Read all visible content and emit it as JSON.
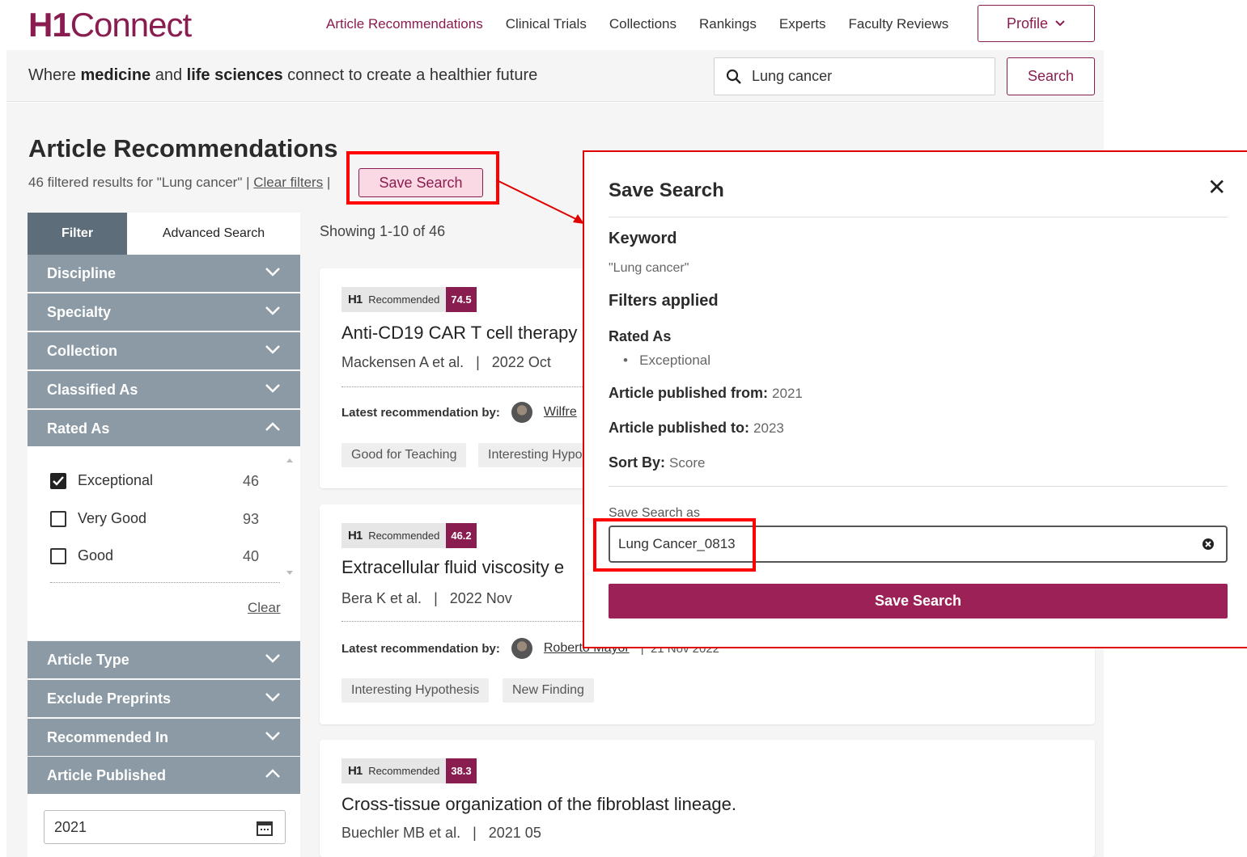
{
  "header": {
    "logo_h1": "H1",
    "logo_rest": "Connect",
    "nav": [
      "Article Recommendations",
      "Clinical Trials",
      "Collections",
      "Rankings",
      "Experts",
      "Faculty Reviews"
    ],
    "profile_label": "Profile",
    "tagline_parts": [
      "Where ",
      "medicine",
      " and ",
      "life sciences",
      " connect to create a healthier future"
    ],
    "search_value": "Lung cancer",
    "search_button": "Search"
  },
  "page": {
    "title": "Article Recommendations",
    "results_text": "46 filtered results for \"Lung cancer\" | ",
    "clear_filters": "Clear filters",
    "separator": " |",
    "save_search_label": "Save Search"
  },
  "sidebar": {
    "tabs": [
      "Filter",
      "Advanced Search"
    ],
    "sections": [
      "Discipline",
      "Specialty",
      "Collection",
      "Classified As",
      "Rated As",
      "Article Type",
      "Exclude Preprints",
      "Recommended In",
      "Article Published"
    ],
    "rated_options": [
      {
        "label": "Exceptional",
        "count": "46",
        "checked": true
      },
      {
        "label": "Very Good",
        "count": "93",
        "checked": false
      },
      {
        "label": "Good",
        "count": "40",
        "checked": false
      }
    ],
    "rated_clear": "Clear",
    "published_from": "2021"
  },
  "results": {
    "showing": "Showing 1-10 of 46",
    "badge_label": "Recommended",
    "latest_label": "Latest recommendation by:",
    "cards": [
      {
        "score": "74.5",
        "title": "Anti-CD19 CAR T cell therapy",
        "authors": "Mackensen A et al.",
        "date": "2022 Oct",
        "recommender": "Wilfre",
        "chips": [
          "Good for Teaching",
          "Interesting Hypo"
        ]
      },
      {
        "score": "46.2",
        "title": "Extracellular fluid viscosity e",
        "authors": "Bera K et al.",
        "date": "2022 Nov",
        "recommender": "Roberto Mayor",
        "rec_date": "21 Nov 2022",
        "chips": [
          "Interesting Hypothesis",
          "New Finding"
        ]
      },
      {
        "score": "38.3",
        "title": "Cross-tissue organization of the fibroblast lineage.",
        "authors": "Buechler MB et al.",
        "date": "2021 05"
      }
    ]
  },
  "modal": {
    "title": "Save Search",
    "keyword_heading": "Keyword",
    "keyword_value": "\"Lung cancer\"",
    "filters_heading": "Filters applied",
    "rated_heading": "Rated As",
    "rated_value": "Exceptional",
    "from_label": "Article published from:",
    "from_value": "2021",
    "to_label": "Article published to:",
    "to_value": "2023",
    "sort_label": "Sort By:",
    "sort_value": "Score",
    "save_as_label": "Save Search as",
    "save_as_value": "Lung Cancer_0813",
    "save_button": "Save Search"
  },
  "colors": {
    "brand": "#8a1d4f",
    "brand_button": "#9b2157",
    "sidebar_header": "#8b9aa4",
    "tab_active": "#5d6e7a",
    "highlight": "#ff0000"
  }
}
